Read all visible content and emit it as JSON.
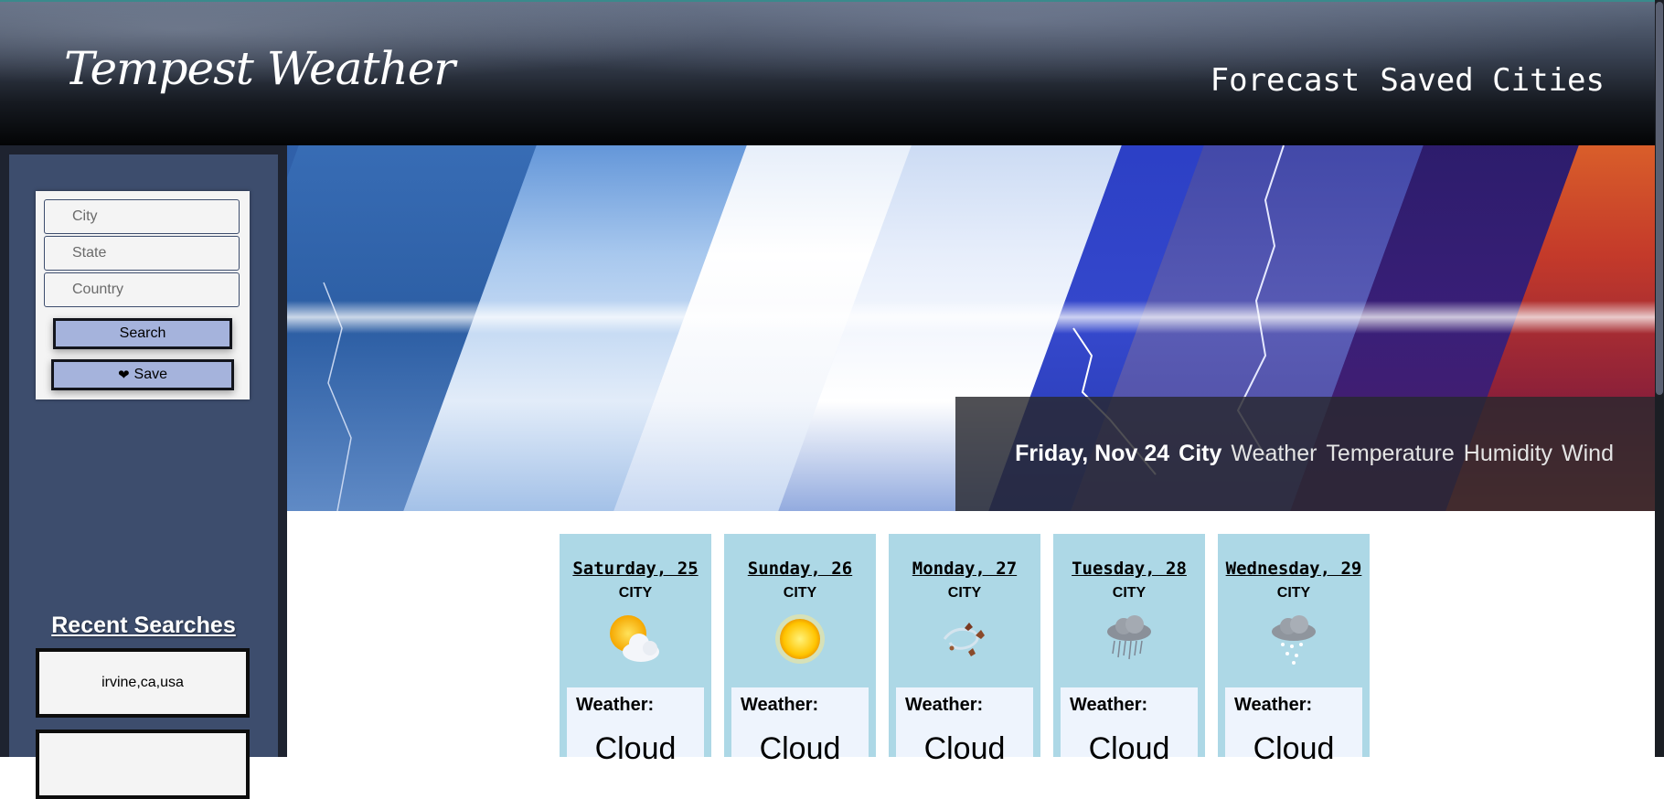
{
  "app": {
    "title": "Tempest Weather",
    "nav": [
      "Forecast",
      "Saved Cities"
    ]
  },
  "search": {
    "city_placeholder": "City",
    "state_placeholder": "State",
    "country_placeholder": "Country",
    "search_label": "Search",
    "save_icon": "heart-icon",
    "save_glyph": "❤",
    "save_label": "Save"
  },
  "recent": {
    "title": "Recent Searches",
    "items": [
      "irvine,ca,usa",
      ""
    ]
  },
  "current": {
    "date": "Friday, Nov 24",
    "city": "City",
    "weather": "Weather",
    "temperature": "Temperature",
    "humidity": "Humidity",
    "wind": "Wind"
  },
  "forecast": [
    {
      "day": "Saturday, 25",
      "city": "CITY",
      "icon": "partly-cloudy-icon",
      "weather_label": "Weather:",
      "weather_value": "Cloud"
    },
    {
      "day": "Sunday, 26",
      "city": "CITY",
      "icon": "sun-icon",
      "weather_label": "Weather:",
      "weather_value": "Cloud"
    },
    {
      "day": "Monday, 27",
      "city": "CITY",
      "icon": "wind-leaves-icon",
      "weather_label": "Weather:",
      "weather_value": "Cloud"
    },
    {
      "day": "Tuesday, 28",
      "city": "CITY",
      "icon": "rain-cloud-icon",
      "weather_label": "Weather:",
      "weather_value": "Cloud"
    },
    {
      "day": "Wednesday, 29",
      "city": "CITY",
      "icon": "snow-cloud-icon",
      "weather_label": "Weather:",
      "weather_value": "Cloud"
    }
  ],
  "colors": {
    "sidebar": "#3d4d6d",
    "button": "#a5b3dc",
    "card": "#add8e6",
    "card_panel": "#eef4fd"
  }
}
